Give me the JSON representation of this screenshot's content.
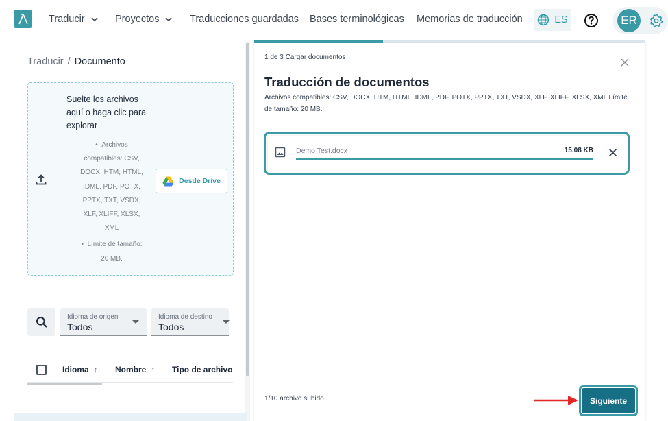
{
  "nav": {
    "items": [
      {
        "label": "Traducir",
        "has_dropdown": true
      },
      {
        "label": "Proyectos",
        "has_dropdown": true
      },
      {
        "label": "Traducciones guardadas",
        "has_dropdown": false
      },
      {
        "label": "Bases terminológicas",
        "has_dropdown": false
      },
      {
        "label": "Memorias de traducción",
        "has_dropdown": false
      }
    ],
    "language": "ES",
    "avatar_initials": "ER",
    "icons": [
      "lambda-logo-icon",
      "chevron-down-icon",
      "globe-icon",
      "help-icon",
      "gear-icon"
    ]
  },
  "breadcrumb": {
    "parent": "Traducir",
    "separator": "/",
    "current": "Documento"
  },
  "dropzone": {
    "title": "Suelte los archivos aquí o haga clic para explorar",
    "bullet_1": "Archivos compatibles: CSV, DOCX, HTM, HTML, IDML, PDF, POTX, PPTX, TXT, VSDX, XLF, XLIFF, XLSX, XML",
    "bullet_2": "Límite de tamaño: 20 MB.",
    "drive_button": "Desde Drive"
  },
  "filters": {
    "source": {
      "label": "Idioma de origen",
      "value": "Todos"
    },
    "target": {
      "label": "Idioma de destino",
      "value": "Todos"
    }
  },
  "table": {
    "columns": [
      {
        "label": "Idioma",
        "sortable": true
      },
      {
        "label": "Nombre",
        "sortable": true
      },
      {
        "label": "Tipo de archivo",
        "sortable": false
      }
    ]
  },
  "modal": {
    "step": "1 de 3 Cargar documentos",
    "step_progress": 0.33,
    "title": "Traducción de documentos",
    "description": "Archivos compatibles: CSV, DOCX, HTM, HTML, IDML, PDF, POTX, PPTX, TXT, VSDX, XLF, XLIFF, XLSX, XML Límite de tamaño: 20 MB.",
    "file": {
      "name": "Demo Test.docx",
      "size": "15.08 KB",
      "upload_progress": 1.0
    },
    "status": "1/10 archivo subido",
    "next_button": "Siguiente"
  },
  "colors": {
    "accent": "#3a9aa6",
    "primary_button": "#176f86",
    "annotation_arrow": "#e32626"
  }
}
